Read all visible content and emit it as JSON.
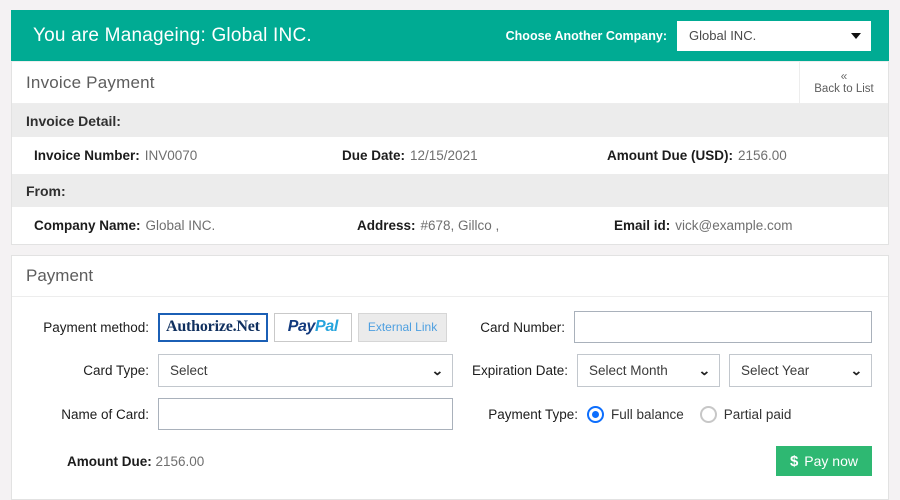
{
  "topbar": {
    "managing_text": "You are Manageing: Global INC.",
    "choose_label": "Choose Another Company:",
    "company_selected": "Global INC.",
    "caret_icon": "chevron-down-icon",
    "accent_color": "#00ab93"
  },
  "invoice_card": {
    "title": "Invoice Payment",
    "back_icon": "double-chevron-left-icon",
    "back_label": "Back to List",
    "detail_section_label": "Invoice Detail:",
    "detail_fields": [
      {
        "key": "Invoice Number:",
        "value": "INV0070"
      },
      {
        "key": "Due Date:",
        "value": "12/15/2021"
      },
      {
        "key": "Amount Due (USD):",
        "value": "2156.00"
      }
    ],
    "from_section_label": "From:",
    "from_fields": [
      {
        "key": "Company Name:",
        "value": "Global INC."
      },
      {
        "key": "Address:",
        "value": "#678, Gillco ,"
      },
      {
        "key": "Email id:",
        "value": "vick@example.com"
      }
    ]
  },
  "payment": {
    "title": "Payment",
    "method_label": "Payment method:",
    "methods": [
      {
        "name": "authorize-net",
        "label": "Authorize.Net",
        "selected": true
      },
      {
        "name": "paypal",
        "label_a": "Pay",
        "label_b": "Pal",
        "selected": false
      },
      {
        "name": "external-link",
        "label": "External Link",
        "selected": false
      }
    ],
    "card_number_label": "Card Number:",
    "card_number_value": "",
    "card_number_placeholder": "",
    "card_type_label": "Card Type:",
    "card_type_value": "Select",
    "expiration_label": "Expiration Date:",
    "expiration_month_value": "Select Month",
    "expiration_year_value": "Select Year",
    "name_of_card_label": "Name of Card:",
    "name_of_card_value": "",
    "name_of_card_placeholder": "",
    "payment_type_label": "Payment Type:",
    "payment_types": [
      {
        "label": "Full balance",
        "selected": true
      },
      {
        "label": "Partial paid",
        "selected": false
      }
    ],
    "amount_due_key": "Amount Due:",
    "amount_due_value": "2156.00",
    "pay_now_icon": "dollar-icon",
    "pay_now_label": "Pay now",
    "pay_now_color": "#2eb872",
    "radio_accent": "#0d6efd"
  }
}
